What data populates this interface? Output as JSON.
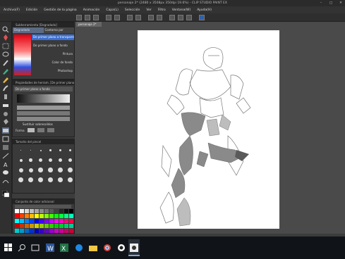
{
  "app": {
    "title": "personaje 2* (2480 x 3508px 350dpi 19.6%) - CLIP STUDIO PAINT EX"
  },
  "menu": [
    "Archivo(F)",
    "Edición",
    "Gestión de la página",
    "Animación",
    "Capa(L)",
    "Selección",
    "Ver",
    "Filtro",
    "Ventana(W)",
    "Ayuda(H)"
  ],
  "subtool_panel": {
    "title": "Subherramienta [Degradado]",
    "tab_left": "Degradado",
    "tab_right": "Contorno por",
    "items": [
      "De primer plano a transparente",
      "De primer plano a fondo",
      "Pintura",
      "Color de fondo",
      "Photoshop"
    ]
  },
  "tool_property": {
    "title": "Propiedades de herram. [De primer plano...",
    "preset": "De primer plano a fondo",
    "sliders": [
      "",
      "",
      "",
      ""
    ],
    "repeat_label": "Sustituir sobresalidos",
    "shape_label": "Forma"
  },
  "brush_panel": {
    "title": "Tamaño del pincel"
  },
  "color_set": {
    "title": "Conjunto de color adicional",
    "colors": [
      "#ffffff",
      "#f2f2f2",
      "#d9d9d9",
      "#bfbfbf",
      "#a6a6a6",
      "#8c8c8c",
      "#737373",
      "#595959",
      "#404040",
      "#262626",
      "#0d0d0d",
      "#000000",
      "#ff0000",
      "#ff4000",
      "#ff8000",
      "#ffbf00",
      "#ffff00",
      "#bfff00",
      "#80ff00",
      "#40ff00",
      "#00ff00",
      "#00ff40",
      "#00ff80",
      "#00ffbf",
      "#00ffff",
      "#00bfff",
      "#0080ff",
      "#0040ff",
      "#0000ff",
      "#4000ff",
      "#8000ff",
      "#bf00ff",
      "#ff00ff",
      "#ff00bf",
      "#ff0080",
      "#ff0040",
      "#cc0000",
      "#cc3300",
      "#cc6600",
      "#cc9900",
      "#cccc00",
      "#99cc00",
      "#66cc00",
      "#33cc00",
      "#00cc00",
      "#00cc33",
      "#00cc66",
      "#00cc99",
      "#00cccc",
      "#0099cc",
      "#0066cc",
      "#0033cc",
      "#0000cc",
      "#3300cc",
      "#6600cc",
      "#9900cc",
      "#cc00cc",
      "#cc0099",
      "#cc0066",
      "#cc0033",
      "#990000",
      "#992600",
      "#994d00",
      "#997300",
      "#999900",
      "#739900",
      "#4d9900",
      "#269900",
      "#009900",
      "#009926",
      "#00994d",
      "#009973",
      "#009999",
      "#007399",
      "#004d99",
      "#002699",
      "#000099",
      "#260099",
      "#4d0099",
      "#730099",
      "#990099",
      "#990073",
      "#99004d",
      "#990026",
      "#ffcccc",
      "#ffe0cc",
      "#fff2cc",
      "#ffffcc",
      "#e6ffcc",
      "#ccffcc",
      "#ccffe6",
      "#ccffff",
      "#cce6ff",
      "#ccccff",
      "#e6ccff",
      "#ffccff",
      "#660000",
      "#663300",
      "#666600",
      "#336600",
      "#006600",
      "#006633",
      "#006666",
      "#003366",
      "#000066",
      "#330066",
      "#660066",
      "#660033",
      "#f4c7a1",
      "#e8a87c",
      "#d08c60",
      "#b5703f",
      "#8c5230",
      "#6b3a1e",
      "#f7e0c8",
      "#efc9a6",
      "#c98f6b",
      "#a66c47",
      "#7d4a2c",
      "#4f2c17"
    ]
  },
  "canvas": {
    "tab": "personaje 2*"
  },
  "taskbar": {
    "icons": [
      "windows-start-icon",
      "search-icon",
      "task-view-icon",
      "word-icon",
      "excel-icon",
      "edge-icon",
      "explorer-icon",
      "chrome-icon",
      "app-icon",
      "clip-studio-icon"
    ]
  }
}
